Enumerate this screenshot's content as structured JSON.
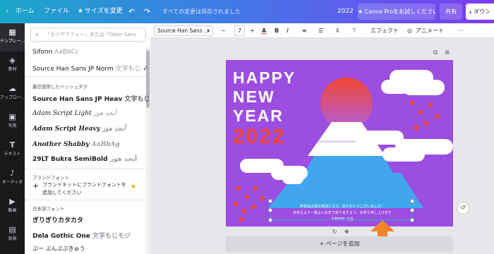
{
  "topbar": {
    "home": "ホーム",
    "file": "ファイル",
    "resize": "サイズを変更",
    "undo_icon": "undo-icon",
    "redo_icon": "redo-icon",
    "saved_status": "すべての変更は保存されました",
    "doc_title": "2022",
    "pro_button": "Canva Proをお試しください",
    "share_button": "共有",
    "download_button": "ダウン"
  },
  "rail": {
    "items": [
      {
        "label": "テンプレー…",
        "icon": "template-icon"
      },
      {
        "label": "素材",
        "icon": "elements-icon"
      },
      {
        "label": "アップロー…",
        "icon": "upload-icon"
      },
      {
        "label": "写真",
        "icon": "photo-icon"
      },
      {
        "label": "テキスト",
        "icon": "text-icon"
      },
      {
        "label": "オーディオ",
        "icon": "audio-icon"
      },
      {
        "label": "動画",
        "icon": "video-icon"
      },
      {
        "label": "背景",
        "icon": "background-icon"
      }
    ]
  },
  "font_panel": {
    "search_placeholder": "「カリグラフィー」または「Open Sans",
    "fonts_top": [
      {
        "name": "Sifonn",
        "sample": "AaBbCc"
      },
      {
        "name": "Source Han Sans JP Norm",
        "sample": "文字もじ"
      }
    ],
    "recent_label": "最近使用したハッシュタグ",
    "recent_fonts": [
      {
        "name": "Source Han Sans JP Heav",
        "sample": "文字もじモジ"
      },
      {
        "name": "Adam Script Light",
        "sample": "أبجد هوز"
      },
      {
        "name": "Adam Script Heavy",
        "sample": "أبجد هوز"
      },
      {
        "name": "Another Shabby",
        "sample": "AaBbAg"
      },
      {
        "name": "29LT Bukra SemiBold",
        "sample": "أبجد هوز"
      }
    ],
    "brand_label": "ブランドフォント",
    "brand_text_1": "ブランドキットにブランドフォントを",
    "brand_text_2": "追加してください",
    "jp_label": "日本語フォント",
    "jp_fonts": [
      {
        "name": "ぎりぎりカタカタ",
        "sample": ""
      },
      {
        "name": "Dela Gothic One",
        "sample": "文字もじモジ"
      },
      {
        "name": "ぶー ぶんぷぷきゅう",
        "sample": ""
      }
    ]
  },
  "format_bar": {
    "font": "Source Han Sans ...",
    "size": "7",
    "effect": "エフェクト",
    "animate": "アニメート",
    "text_color": "#e5322d"
  },
  "design": {
    "line1": "HAPPY",
    "line2": "NEW",
    "line3": "YEAR",
    "year": "2022",
    "msg1": "昨年は大変お世話になり、ありがとうございました！",
    "msg2": "本年もより一層よいお年でありますよう、お祈り申し上げます",
    "msg3": "令和四年 元旦",
    "bg_color": "#9b4ee0",
    "accent_red": "#f0473c"
  },
  "add_page": "+ ページを追加"
}
